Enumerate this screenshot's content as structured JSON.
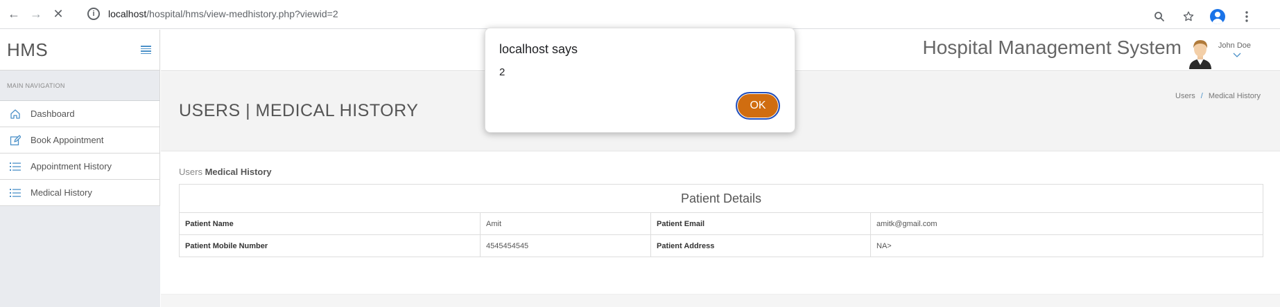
{
  "browser": {
    "back_icon": "←",
    "forward_icon": "→",
    "stop_icon": "✕",
    "url_host": "localhost",
    "url_path": "/hospital/hms/view-medhistory.php?viewid=2"
  },
  "sidebar": {
    "brand": "HMS",
    "nav_label": "MAIN NAVIGATION",
    "items": [
      {
        "label": "Dashboard",
        "icon": "home-icon"
      },
      {
        "label": "Book Appointment",
        "icon": "edit-icon"
      },
      {
        "label": "Appointment History",
        "icon": "list-icon"
      },
      {
        "label": "Medical History",
        "icon": "list-icon"
      }
    ]
  },
  "topbar": {
    "app_title": "Hospital Management System",
    "user_name": "John Doe"
  },
  "page": {
    "title": "USERS | MEDICAL HISTORY",
    "breadcrumb_1": "Users",
    "breadcrumb_sep": "/",
    "breadcrumb_2": "Medical History",
    "section_prefix": "Users",
    "section_title": "Medical History"
  },
  "patient_table": {
    "heading": "Patient Details",
    "rows": [
      {
        "label1": "Patient Name",
        "value1": "Amit",
        "label2": "Patient Email",
        "value2": "amitk@gmail.com"
      },
      {
        "label1": "Patient Mobile Number",
        "value1": "4545454545",
        "label2": "Patient Address",
        "value2": "NA>"
      }
    ]
  },
  "dialog": {
    "title": "localhost says",
    "message": "2",
    "ok_label": "OK"
  },
  "colors": {
    "accent": "#4a90c8",
    "ok_button": "#d06d10"
  }
}
